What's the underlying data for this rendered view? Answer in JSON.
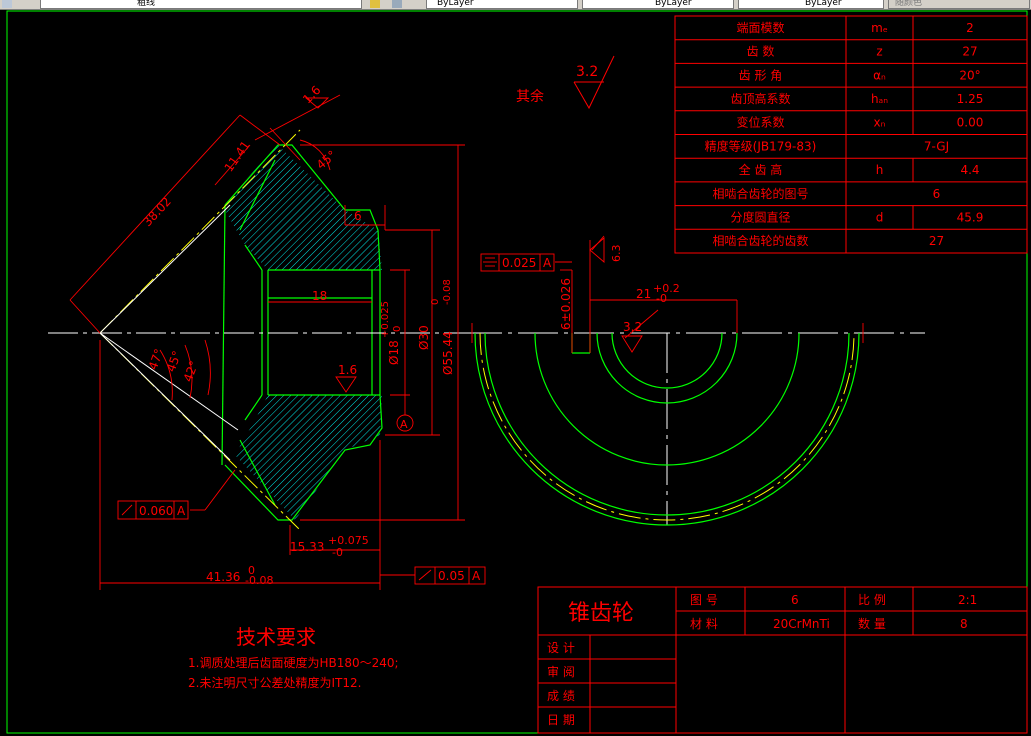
{
  "toolbar": {
    "layer_combo": "粗线",
    "color_combo": "ByLayer",
    "linetype_combo": "ByLayer",
    "lineweight_combo": "ByLayer",
    "plotstyle_combo": "随颜色"
  },
  "note_remaining": "其余",
  "roughness_general": "3.2",
  "dimensions": {
    "roughness_top": "1.6",
    "d_11_41": "11.41",
    "d_38_02": "38.02",
    "angle_45_top": "45°",
    "d_6": "6",
    "d_18": "18",
    "d_18_bore": "Ø18",
    "d_18_tol_upper": "+0.025",
    "d_18_tol_lower": "0",
    "d_30": "Ø30",
    "d_55": "Ø55.44",
    "d_55_tol_upper": "0",
    "d_55_tol_lower": "-0.08",
    "roughness_bore": "1.6",
    "angle_47": "47°",
    "angle_45": "45°",
    "angle_42": "42°",
    "datum_a": "A",
    "runout_tol": "0.060",
    "runout_ref": "A",
    "d_15_33": "15.33",
    "d_15_tol_upper": "+0.075",
    "d_15_tol_lower": "-0",
    "d_41_36": "41.36",
    "d_41_tol_upper": "0",
    "d_41_tol_lower": "-0.08",
    "runout2_tol": "0.05",
    "runout2_ref": "A",
    "sym_tol": "0.025",
    "sym_ref": "A",
    "roughness_keyway": "6.3",
    "d_keyway": "6±0.026",
    "d_21": "21",
    "d_21_tol_upper": "+0.2",
    "d_21_tol_lower": "-0",
    "roughness_keyway2": "3.2"
  },
  "param_table": [
    [
      "端面模数",
      "mₑ",
      "2"
    ],
    [
      "齿      数",
      "z",
      "27"
    ],
    [
      "齿 形 角",
      "αₙ",
      "20°"
    ],
    [
      "齿顶高系数",
      "hₐₙ",
      "1.25"
    ],
    [
      "变位系数",
      "xₙ",
      "0.00"
    ],
    [
      "精度等级(JB179-83)",
      "",
      "7-GJ"
    ],
    [
      "全 齿 高",
      "h",
      "4.4"
    ],
    [
      "相啮合齿轮的图号",
      "",
      "6"
    ],
    [
      "分度圆直径",
      "d",
      "45.9"
    ],
    [
      "相啮合齿轮的齿数",
      "",
      "27"
    ]
  ],
  "tech_req": {
    "title": "技术要求",
    "items": [
      "1.调质处理后齿面硬度为HB180～240;",
      "2.未注明尺寸公差处精度为IT12."
    ]
  },
  "title_block": {
    "part_name": "锥齿轮",
    "drawing_no_label": "图   号",
    "drawing_no": "6",
    "scale_label": "比   例",
    "scale": "2:1",
    "material_label": "材   料",
    "material": "20CrMnTi",
    "quantity_label": "数   量",
    "quantity": "8",
    "design": "设 计",
    "review": "审 阅",
    "grade": "成 绩",
    "date": "日 期"
  },
  "colors": {
    "frame": "#ff0000",
    "outline": "#00ff00",
    "center": "#ffffff",
    "hatch": "#00ffff",
    "pitch": "#ffff00",
    "dimension": "#ff0000"
  }
}
